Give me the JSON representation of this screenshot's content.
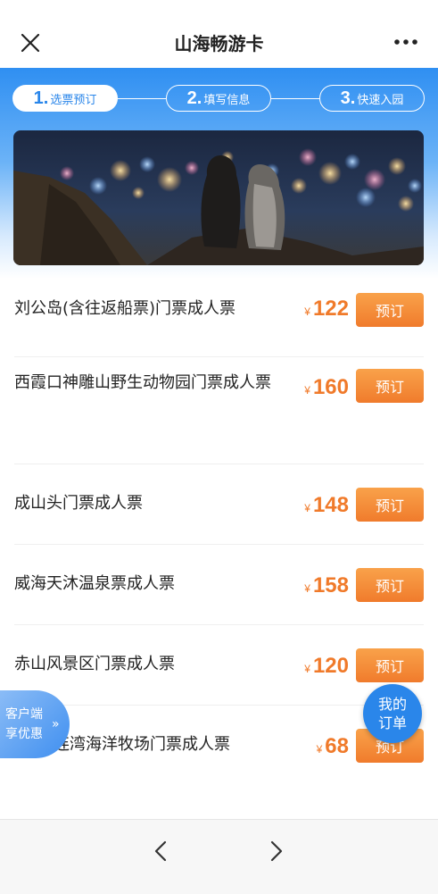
{
  "nav": {
    "title": "山海畅游卡"
  },
  "steps": [
    {
      "num": "1.",
      "label": "选票预订",
      "active": true
    },
    {
      "num": "2.",
      "label": "填写信息",
      "active": false
    },
    {
      "num": "3.",
      "label": "快速入园",
      "active": false
    }
  ],
  "tickets": [
    {
      "name": "刘公岛(含往返船票)门票成人票",
      "currency": "¥",
      "price": "122",
      "button": "预订"
    },
    {
      "name": "西霞口神雕山野生动物园门票成人票",
      "currency": "¥",
      "price": "160",
      "button": "预订"
    },
    {
      "name": "成山头门票成人票",
      "currency": "¥",
      "price": "148",
      "button": "预订"
    },
    {
      "name": "威海天沐温泉票成人票",
      "currency": "¥",
      "price": "158",
      "button": "预订"
    },
    {
      "name": "赤山风景区门票成人票",
      "currency": "¥",
      "price": "120",
      "button": "预订"
    },
    {
      "name": "连湾海洋牧场门票成人票",
      "currency": "¥",
      "price": "68",
      "button": "预订"
    }
  ],
  "promo": {
    "line1": "客户端",
    "line2": "享优惠",
    "arrow": "»"
  },
  "orders": {
    "line1": "我的",
    "line2": "订单"
  },
  "colors": {
    "accent": "#2a86ea",
    "price": "#f07a2a",
    "button": "#f59034"
  },
  "icons": {
    "close": "close-icon",
    "more": "more-icon",
    "prev": "chevron-left-icon",
    "next": "chevron-right-icon"
  }
}
